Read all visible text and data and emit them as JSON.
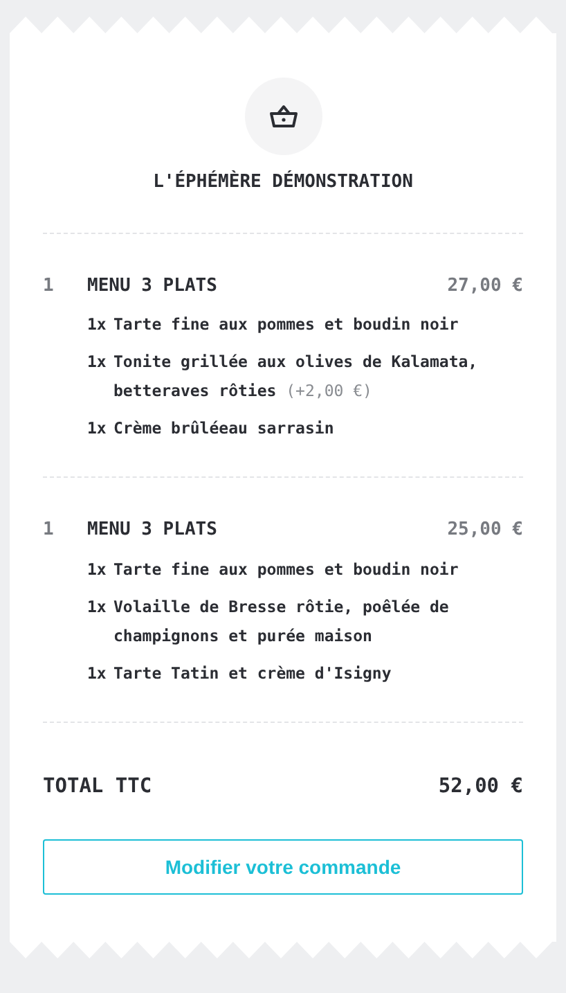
{
  "restaurant": {
    "title": "L'ÉPHÉMÈRE DÉMONSTRATION"
  },
  "order_lines": [
    {
      "quantity": "1",
      "name": "MENU 3 PLATS",
      "price": "27,00 €",
      "dishes": [
        {
          "quantity": "1x",
          "name": "Tarte fine aux pommes et boudin noir"
        },
        {
          "quantity": "1x",
          "name": "Tonite grillée aux olives de Kalamata, betteraves rôties",
          "extra": "(+2,00 €)"
        },
        {
          "quantity": "1x",
          "name": "Crème brûléeau sarrasin"
        }
      ]
    },
    {
      "quantity": "1",
      "name": "MENU 3 PLATS",
      "price": "25,00 €",
      "dishes": [
        {
          "quantity": "1x",
          "name": "Tarte fine aux pommes et boudin noir"
        },
        {
          "quantity": "1x",
          "name": "Volaille de Bresse rôtie, poêlée de champignons et purée maison"
        },
        {
          "quantity": "1x",
          "name": "Tarte Tatin et crème d'Isigny"
        }
      ]
    }
  ],
  "total": {
    "label": "TOTAL TTC",
    "amount": "52,00 €"
  },
  "button": "Modifier votre commande"
}
